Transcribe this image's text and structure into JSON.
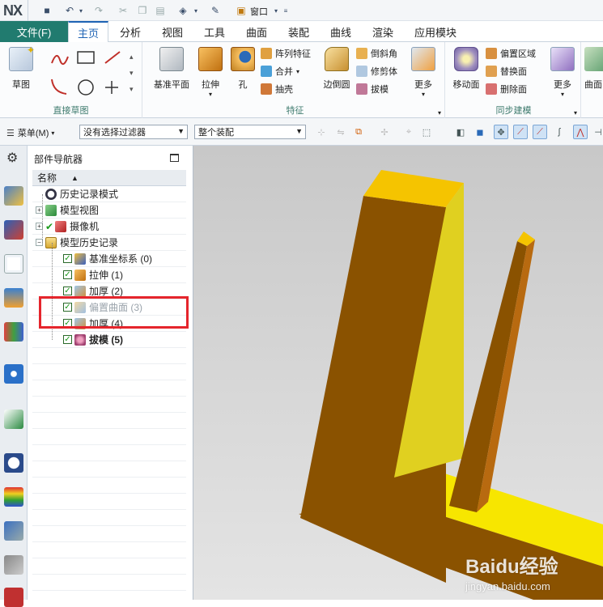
{
  "app": {
    "logo": "NX",
    "window_menu": "窗口"
  },
  "tabs": {
    "file": "文件(F)",
    "items": [
      "主页",
      "分析",
      "视图",
      "工具",
      "曲面",
      "装配",
      "曲线",
      "渲染",
      "应用模块"
    ]
  },
  "ribbon": {
    "sketch": {
      "label": "草图",
      "group_label": "直接草图"
    },
    "feature": {
      "datum_plane": "基准平面",
      "extrude": "拉伸",
      "hole": "孔",
      "pattern": "阵列特征",
      "unite": "合并",
      "shell": "抽壳",
      "edge_blend": "边倒圆",
      "chamfer": "倒斜角",
      "trim_body": "修剪体",
      "draft": "拔模",
      "more": "更多",
      "group_label": "特征"
    },
    "sync": {
      "move_face": "移动面",
      "offset_region": "偏置区域",
      "replace_face": "替换面",
      "delete_face": "删除面",
      "more": "更多",
      "group_label": "同步建模"
    },
    "surface": {
      "label": "曲面"
    }
  },
  "selection_bar": {
    "menu": "菜单(M)",
    "filter": "没有选择过滤器",
    "scope": "整个装配"
  },
  "navigator": {
    "title": "部件导航器",
    "column_name": "名称",
    "rows": [
      {
        "label": "历史记录模式"
      },
      {
        "label": "模型视图"
      },
      {
        "label": "摄像机"
      },
      {
        "label": "模型历史记录"
      },
      {
        "label": "基准坐标系 (0)"
      },
      {
        "label": "拉伸 (1)"
      },
      {
        "label": "加厚 (2)"
      },
      {
        "label": "偏置曲面 (3)"
      },
      {
        "label": "加厚 (4)"
      },
      {
        "label": "拔模 (5)"
      }
    ]
  },
  "watermark": {
    "brand": "Baidu经验",
    "url": "jingyan.baidu.com"
  },
  "colors": {
    "file_tab": "#217b6f",
    "accent": "#1e63b4",
    "highlight": "#e5252c",
    "part_body": "#8a5200",
    "part_face": "#f2d400"
  }
}
